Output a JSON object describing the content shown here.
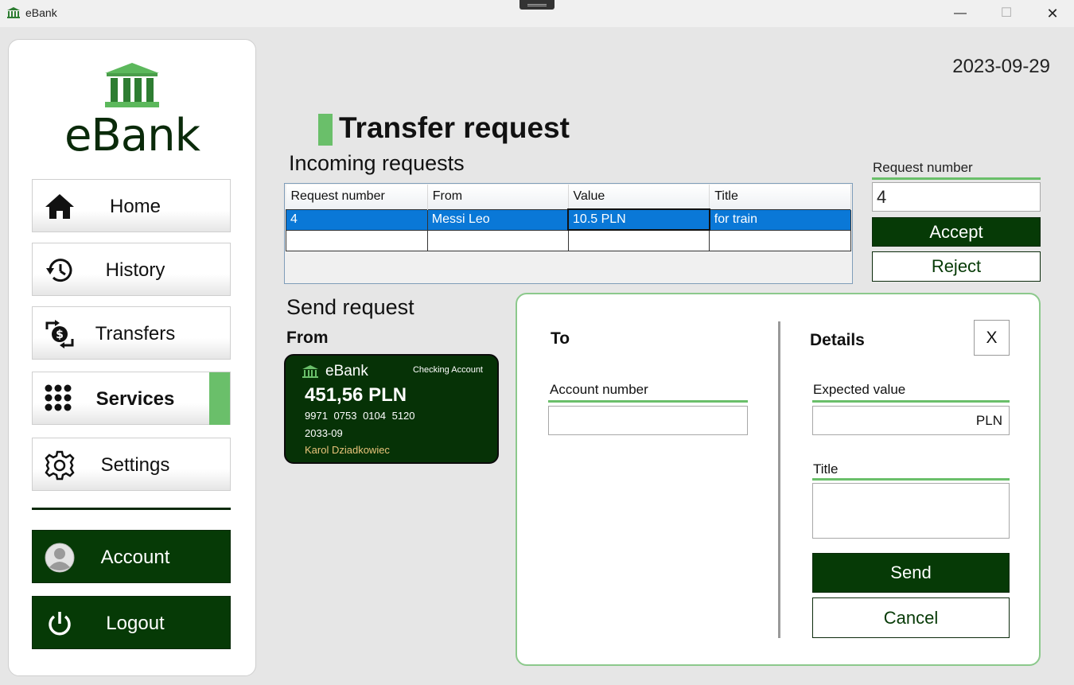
{
  "window": {
    "title": "eBank",
    "minimize_glyph": "—",
    "maximize_glyph": "☐",
    "close_glyph": "✕"
  },
  "sidebar": {
    "logo_text": "eBank",
    "nav": [
      {
        "label": "Home",
        "icon": "home-icon"
      },
      {
        "label": "History",
        "icon": "history-icon"
      },
      {
        "label": "Transfers",
        "icon": "transfers-icon"
      },
      {
        "label": "Services",
        "icon": "services-icon",
        "active": true
      },
      {
        "label": "Settings",
        "icon": "settings-icon"
      }
    ],
    "account_label": "Account",
    "logout_label": "Logout"
  },
  "header": {
    "date": "2023-09-29",
    "title": "Transfer request"
  },
  "incoming": {
    "heading": "Incoming requests",
    "columns": [
      "Request number",
      "From",
      "Value",
      "Title"
    ],
    "rows": [
      [
        "4",
        "Messi Leo",
        "10.5 PLN",
        "for train"
      ]
    ]
  },
  "request_panel": {
    "label": "Request number",
    "value": "4",
    "accept_label": "Accept",
    "reject_label": "Reject"
  },
  "send": {
    "heading": "Send request",
    "from_label": "From",
    "card": {
      "bank": "eBank",
      "type": "Checking Account",
      "balance": "451,56 PLN",
      "number": "9971 0753 0104 5120",
      "expiry": "2033-09",
      "holder": "Karol Dziadkowiec"
    },
    "to_label": "To",
    "account_number_label": "Account number",
    "account_number_value": "",
    "details_label": "Details",
    "close_label": "X",
    "expected_value_label": "Expected value",
    "expected_value_suffix": "PLN",
    "title_label": "Title",
    "title_value": "",
    "send_label": "Send",
    "cancel_label": "Cancel"
  },
  "colors": {
    "dark_green": "#063a06",
    "accent_green": "#6abf6a",
    "selection_blue": "#0a78d7",
    "card_holder_gold": "#e8c37a"
  }
}
